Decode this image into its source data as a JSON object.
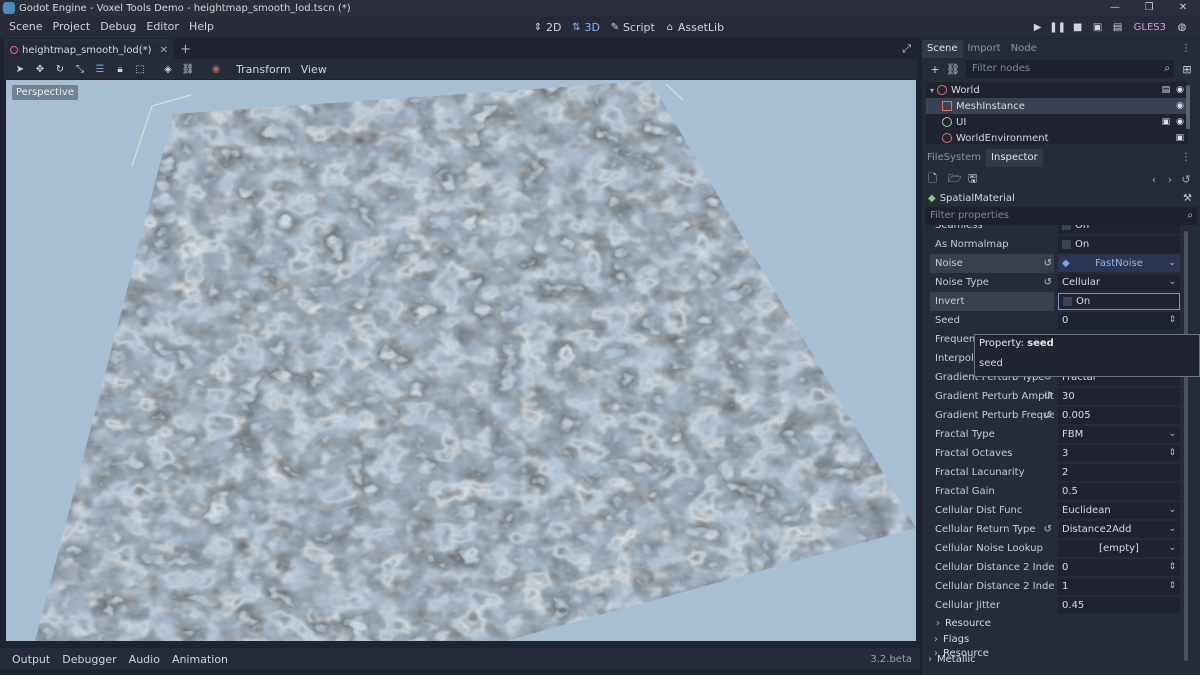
{
  "window": {
    "title": "Godot Engine - Voxel Tools Demo - heightmap_smooth_lod.tscn (*)",
    "controls": [
      "—",
      "❐",
      "✕"
    ]
  },
  "menu": [
    "Scene",
    "Project",
    "Debug",
    "Editor",
    "Help"
  ],
  "modes": [
    {
      "label": "2D",
      "icon": "2d-icon"
    },
    {
      "label": "3D",
      "icon": "3d-icon"
    },
    {
      "label": "Script",
      "icon": "script-icon"
    },
    {
      "label": "AssetLib",
      "icon": "assetlib-icon"
    }
  ],
  "renderer": "GLES3",
  "scene_tab": {
    "label": "heightmap_smooth_lod(*)"
  },
  "viewport_toolbar": {
    "transform": "Transform",
    "view": "View"
  },
  "viewport": {
    "label": "Perspective"
  },
  "bottom_panel": {
    "tabs": [
      "Output",
      "Debugger",
      "Audio",
      "Animation"
    ],
    "version": "3.2.beta"
  },
  "scene_dock": {
    "tabs": [
      "Scene",
      "Import",
      "Node"
    ],
    "filter_placeholder": "Filter nodes",
    "nodes": [
      {
        "name": "World",
        "icon_color": "#e07070"
      },
      {
        "name": "MeshInstance",
        "icon_color": "#e07070"
      },
      {
        "name": "UI",
        "icon_color": "#8fdc8f"
      },
      {
        "name": "WorldEnvironment",
        "icon_color": "#e07070"
      }
    ]
  },
  "inspector_dock": {
    "tabs": [
      "FileSystem",
      "Inspector"
    ],
    "object": "SpatialMaterial",
    "filter_placeholder": "Filter properties",
    "partial_top": "Seamless",
    "partial_top_value": "On",
    "properties": [
      {
        "name": "As Normalmap",
        "value": "On"
      },
      {
        "name": "Noise",
        "value": "FastNoise"
      },
      {
        "name": "Noise Type",
        "value": "Cellular"
      },
      {
        "name": "Invert",
        "value": "On"
      },
      {
        "name": "Seed",
        "value": "0"
      },
      {
        "name": "Frequency",
        "value": ""
      },
      {
        "name": "Interpolation",
        "value": ""
      },
      {
        "name": "Gradient Perturb Type",
        "value": "Fractal"
      },
      {
        "name": "Gradient Perturb Amplitude",
        "value": "30"
      },
      {
        "name": "Gradient Perturb Frequency",
        "value": "0.005"
      },
      {
        "name": "Fractal Type",
        "value": "FBM"
      },
      {
        "name": "Fractal Octaves",
        "value": "3"
      },
      {
        "name": "Fractal Lacunarity",
        "value": "2"
      },
      {
        "name": "Fractal Gain",
        "value": "0.5"
      },
      {
        "name": "Cellular Dist Func",
        "value": "Euclidean"
      },
      {
        "name": "Cellular Return Type",
        "value": "Distance2Add"
      },
      {
        "name": "Cellular Noise Lookup",
        "value": "[empty]"
      },
      {
        "name": "Cellular Distance 2 Index 0",
        "value": "0"
      },
      {
        "name": "Cellular Distance 2 Index 1",
        "value": "1"
      },
      {
        "name": "Cellular Jitter",
        "value": "0.45"
      }
    ],
    "sections": [
      "Resource",
      "Flags",
      "Resource",
      "Metallic"
    ]
  },
  "tooltip": {
    "prefix": "Property: ",
    "property": "seed",
    "description": "seed"
  }
}
